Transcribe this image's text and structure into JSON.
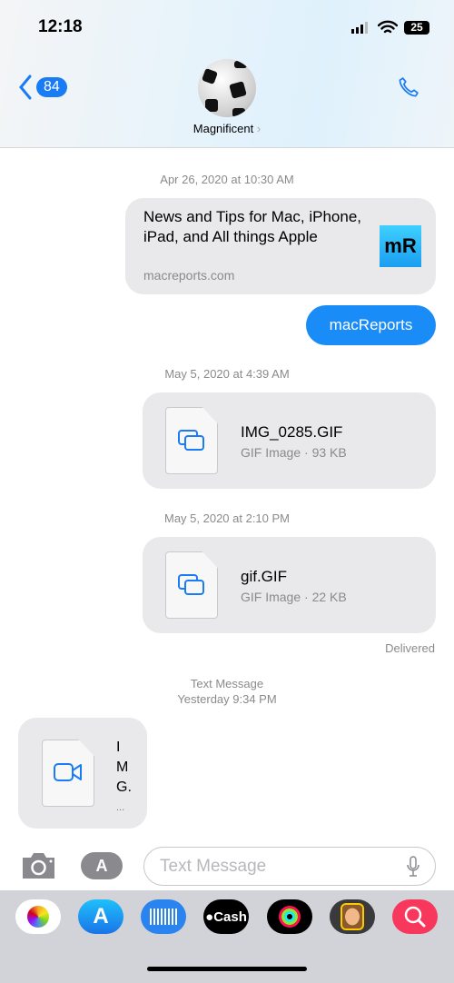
{
  "status": {
    "time": "12:18",
    "battery": "25"
  },
  "header": {
    "back_count": "84",
    "contact_name": "Magnificent",
    "chevron": "›"
  },
  "messages": {
    "ts1": "Apr 26, 2020 at 10:30 AM",
    "link": {
      "title": "News and Tips for Mac, iPhone, iPad, and All things Apple",
      "domain": "macreports.com",
      "icon_text": "mR"
    },
    "text1": "macReports",
    "ts2": "May 5, 2020 at 4:39 AM",
    "file1": {
      "name": "IMG_0285.GIF",
      "meta": "GIF Image · 93 KB"
    },
    "ts3": "May 5, 2020 at 2:10 PM",
    "file2": {
      "name": "gif.GIF",
      "meta": "GIF Image · 22 KB"
    },
    "delivered": "Delivered",
    "ts4_label": "Text Message",
    "ts4_time": "Yesterday 9:34 PM",
    "incoming": {
      "name_chars": [
        "I",
        "M",
        "G."
      ],
      "ellipsis": "..."
    }
  },
  "input": {
    "placeholder": "Text Message"
  },
  "tray": {
    "cash_label": "Cash"
  },
  "colors": {
    "accent": "#1a7cf5",
    "bubble_gray": "#e9e9eb",
    "tray_bg": "#d1d3d9"
  }
}
